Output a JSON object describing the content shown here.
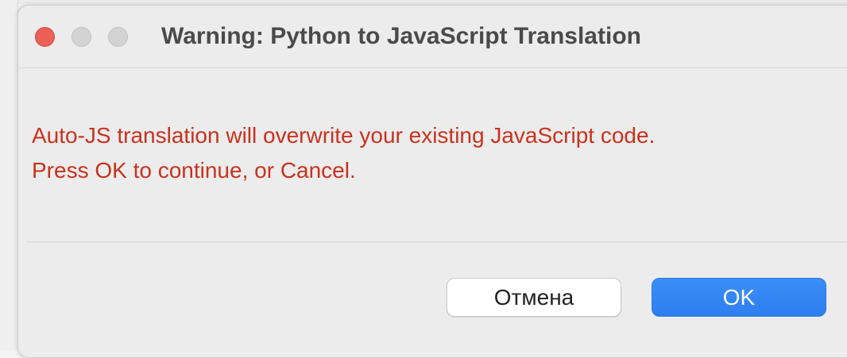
{
  "dialog": {
    "title": "Warning: Python to JavaScript Translation",
    "message_line1": "Auto-JS translation will overwrite your existing JavaScript code.",
    "message_line2": "Press OK to continue, or Cancel.",
    "message_color": "#c8321e",
    "window_controls": [
      "close",
      "minimize",
      "zoom"
    ]
  },
  "buttons": {
    "cancel_label": "Отмена",
    "ok_label": "OK",
    "ok_color": "#2e7ef0"
  }
}
